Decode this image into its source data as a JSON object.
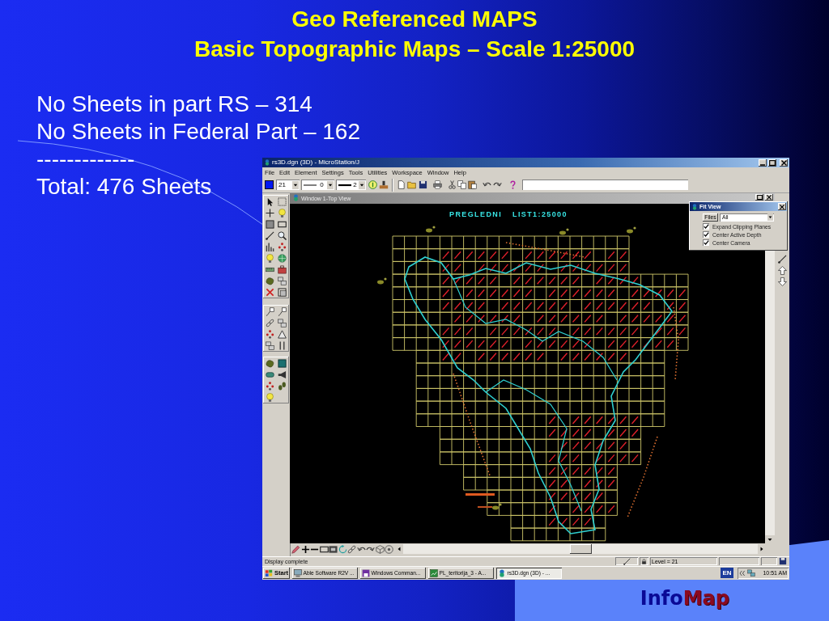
{
  "slide": {
    "title": "Geo Referenced MAPS",
    "subtitle": "Basic Topographic Maps – Scale 1:25000",
    "body_lines": [
      "No Sheets in part RS – 314",
      "No Sheets in Federal Part – 162",
      "-------------",
      "Total: 476 Sheets"
    ]
  },
  "app_window": {
    "title": "rs3D.dgn (3D) - MicroStation/J",
    "menu": [
      "File",
      "Edit",
      "Element",
      "Settings",
      "Tools",
      "Utilities",
      "Workspace",
      "Window",
      "Help"
    ],
    "toolbar": {
      "active_color_index": "21",
      "line_style": "0",
      "line_weight": "2"
    }
  },
  "view_window": {
    "title": "Window 1-Top View",
    "map_title": "PREGLEDNI LIST1:25000"
  },
  "fit_view": {
    "title": "Fit View",
    "files_button": "Files",
    "files_value": "All",
    "options": [
      {
        "label": "Expand Clipping Planes",
        "checked": true
      },
      {
        "label": "Center Active Depth",
        "checked": true
      },
      {
        "label": "Center Camera",
        "checked": true
      }
    ]
  },
  "status_bar": {
    "message": "Display complete",
    "level_field": "Level = 21"
  },
  "taskbar": {
    "start": "Start",
    "tasks": [
      {
        "label": "Able Software R2V ...",
        "selected": false
      },
      {
        "label": "Windows Comman...",
        "selected": false
      },
      {
        "label": "PL_teritorija_3 - A...",
        "selected": false
      },
      {
        "label": "rs3D.dgn (3D) - ...",
        "selected": true
      }
    ],
    "language": "EN",
    "clock": "10:51 AM"
  },
  "logo": {
    "part_1": "Info",
    "part_2": "Map"
  }
}
